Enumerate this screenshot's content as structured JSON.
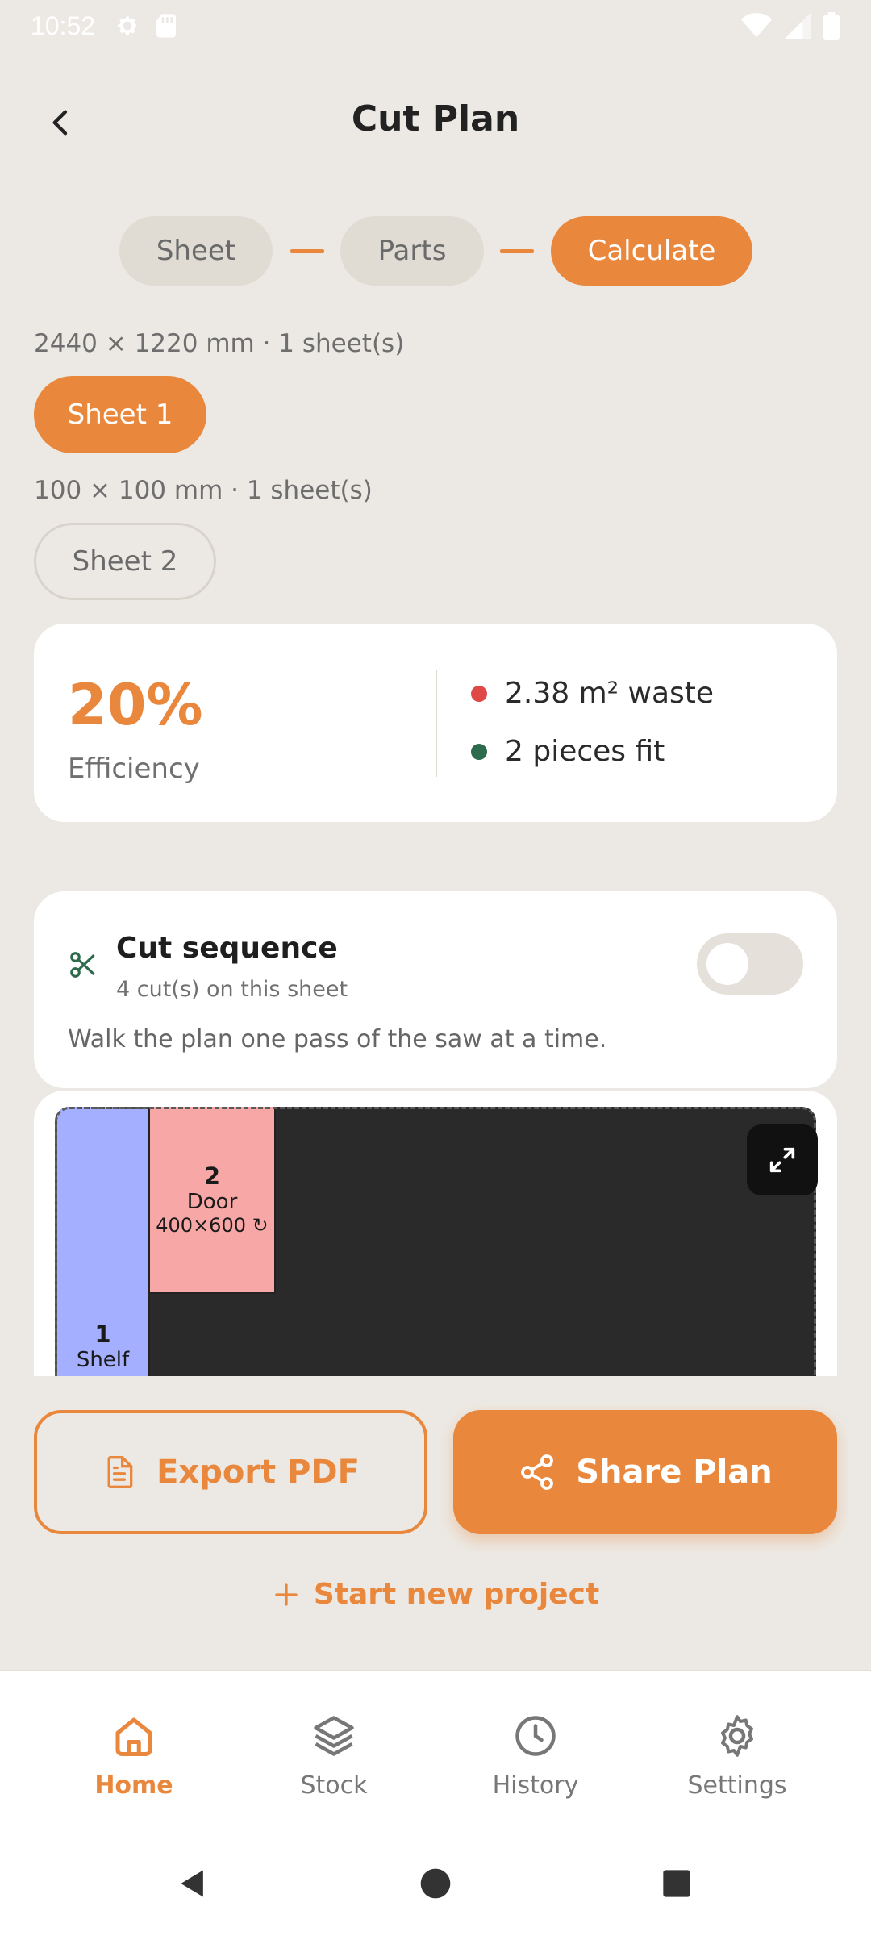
{
  "status_bar": {
    "time": "10:52"
  },
  "header": {
    "title": "Cut Plan"
  },
  "stepper": {
    "steps": [
      "Sheet",
      "Parts",
      "Calculate"
    ]
  },
  "sheets": [
    {
      "meta": "2440 × 1220 mm · 1 sheet(s)",
      "label": "Sheet 1"
    },
    {
      "meta": "100 × 100 mm · 1 sheet(s)",
      "label": "Sheet 2"
    }
  ],
  "efficiency": {
    "value": "20%",
    "label": "Efficiency",
    "waste": "2.38 m² waste",
    "fit": "2 pieces fit",
    "waste_color": "#E04848",
    "fit_color": "#2E6B4C"
  },
  "cut_sequence": {
    "title": "Cut sequence",
    "subtitle": "4 cut(s) on this sheet",
    "description": "Walk the plan one pass of the saw at a time.",
    "enabled": false
  },
  "plan": {
    "pieces": [
      {
        "number": "1",
        "name": "Shelf",
        "dims": ""
      },
      {
        "number": "2",
        "name": "Door",
        "dims": "400×600 ↻"
      }
    ]
  },
  "actions": {
    "export": "Export PDF",
    "share": "Share Plan",
    "new_project": "Start new project"
  },
  "nav": {
    "items": [
      "Home",
      "Stock",
      "History",
      "Settings"
    ],
    "active": "Home"
  },
  "colors": {
    "accent": "#E9873C",
    "background": "#ECE9E4"
  }
}
